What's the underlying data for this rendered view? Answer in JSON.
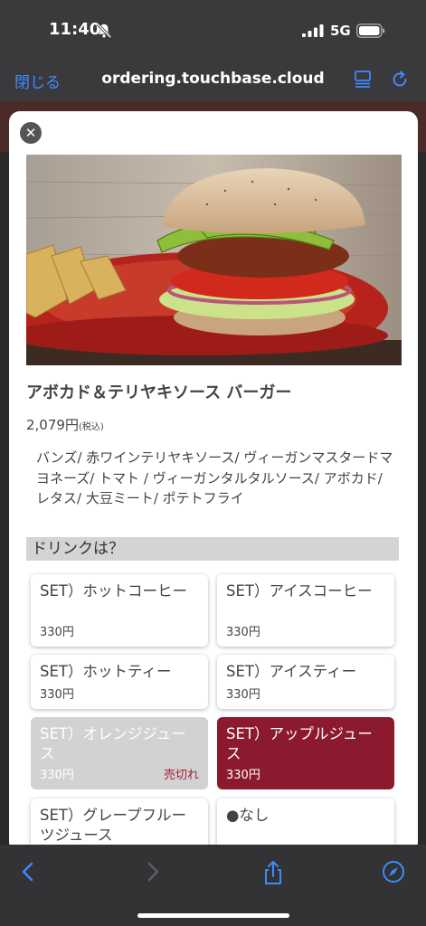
{
  "status_bar": {
    "time": "11:40",
    "network": "5G",
    "icons": [
      "bell-off-icon",
      "signal-icon",
      "battery-icon"
    ]
  },
  "browser": {
    "close_label": "閉じる",
    "url": "ordering.touchbase.cloud",
    "accent": "#3d8bff"
  },
  "item": {
    "title": "アボカド＆テリヤキソース バーガー",
    "price": "2,079円",
    "tax_note": "(税込)",
    "description": "バンズ/ 赤ワインテリヤキソース/ ヴィーガンマスタードマヨネーズ/ トマト / ヴィーガンタルタルソース/ アボカド/ レタス/ 大豆ミート/ ポテトフライ",
    "image": "avocado-teriyaki-burger-photo"
  },
  "section": {
    "heading": "ドリンクは？"
  },
  "options": [
    {
      "name": "SET）ホットコーヒー",
      "price": "330円",
      "state": "normal"
    },
    {
      "name": "SET）アイスコーヒー",
      "price": "330円",
      "state": "normal"
    },
    {
      "name": "SET）ホットティー",
      "price": "330円",
      "state": "normal"
    },
    {
      "name": "SET）アイスティー",
      "price": "330円",
      "state": "normal"
    },
    {
      "name": "SET）オレンジジュース",
      "price": "330円",
      "state": "sold_out",
      "sold_label": "売切れ"
    },
    {
      "name": "SET）アップルジュース",
      "price": "330円",
      "state": "selected"
    },
    {
      "name": "SET）グレープフルーツジュース",
      "price": "",
      "state": "normal"
    },
    {
      "name": "●なし",
      "price": "",
      "state": "normal"
    }
  ],
  "colors": {
    "selected_bg": "#8c1a2e",
    "sold_bg": "#d2d2d2",
    "sold_text": "#a02030"
  },
  "toolbar": {
    "icons": [
      "back-icon",
      "forward-icon",
      "share-icon",
      "compass-icon"
    ]
  }
}
